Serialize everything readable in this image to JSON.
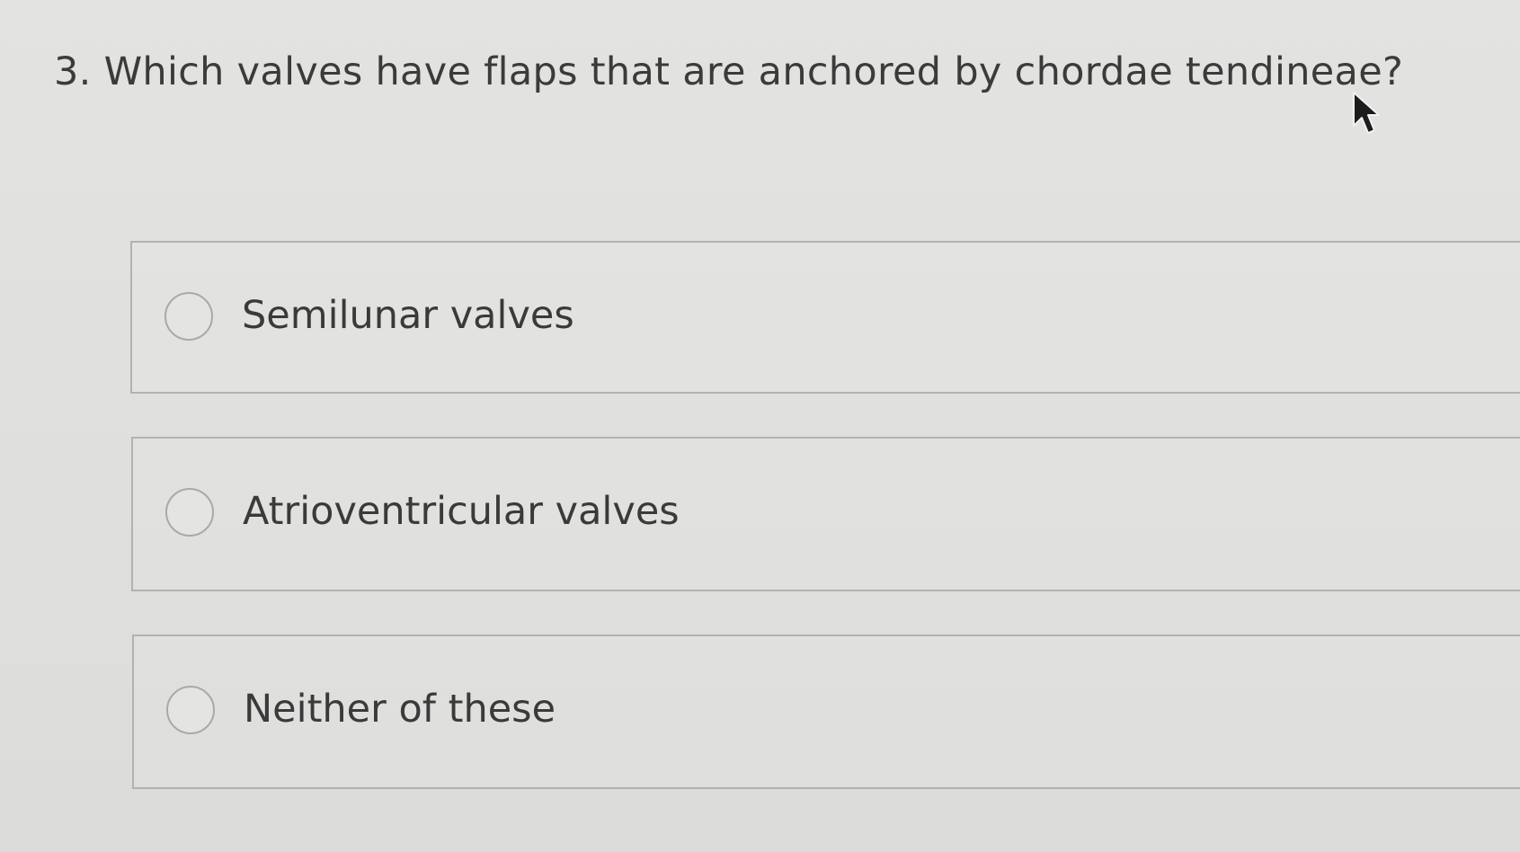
{
  "question": {
    "text": "3. Which valves have flaps that are anchored by chordae tendineae?"
  },
  "options": [
    {
      "label": "Semilunar valves",
      "selected": false
    },
    {
      "label": "Atrioventricular valves",
      "selected": false
    },
    {
      "label": "Neither of these",
      "selected": false
    }
  ],
  "icons": {
    "cursor": "mouse-pointer-icon",
    "radio": "radio-button-icon"
  },
  "colors": {
    "background": "#e0e0de",
    "text": "#3a3a3a",
    "border": "#b2b2b0"
  }
}
